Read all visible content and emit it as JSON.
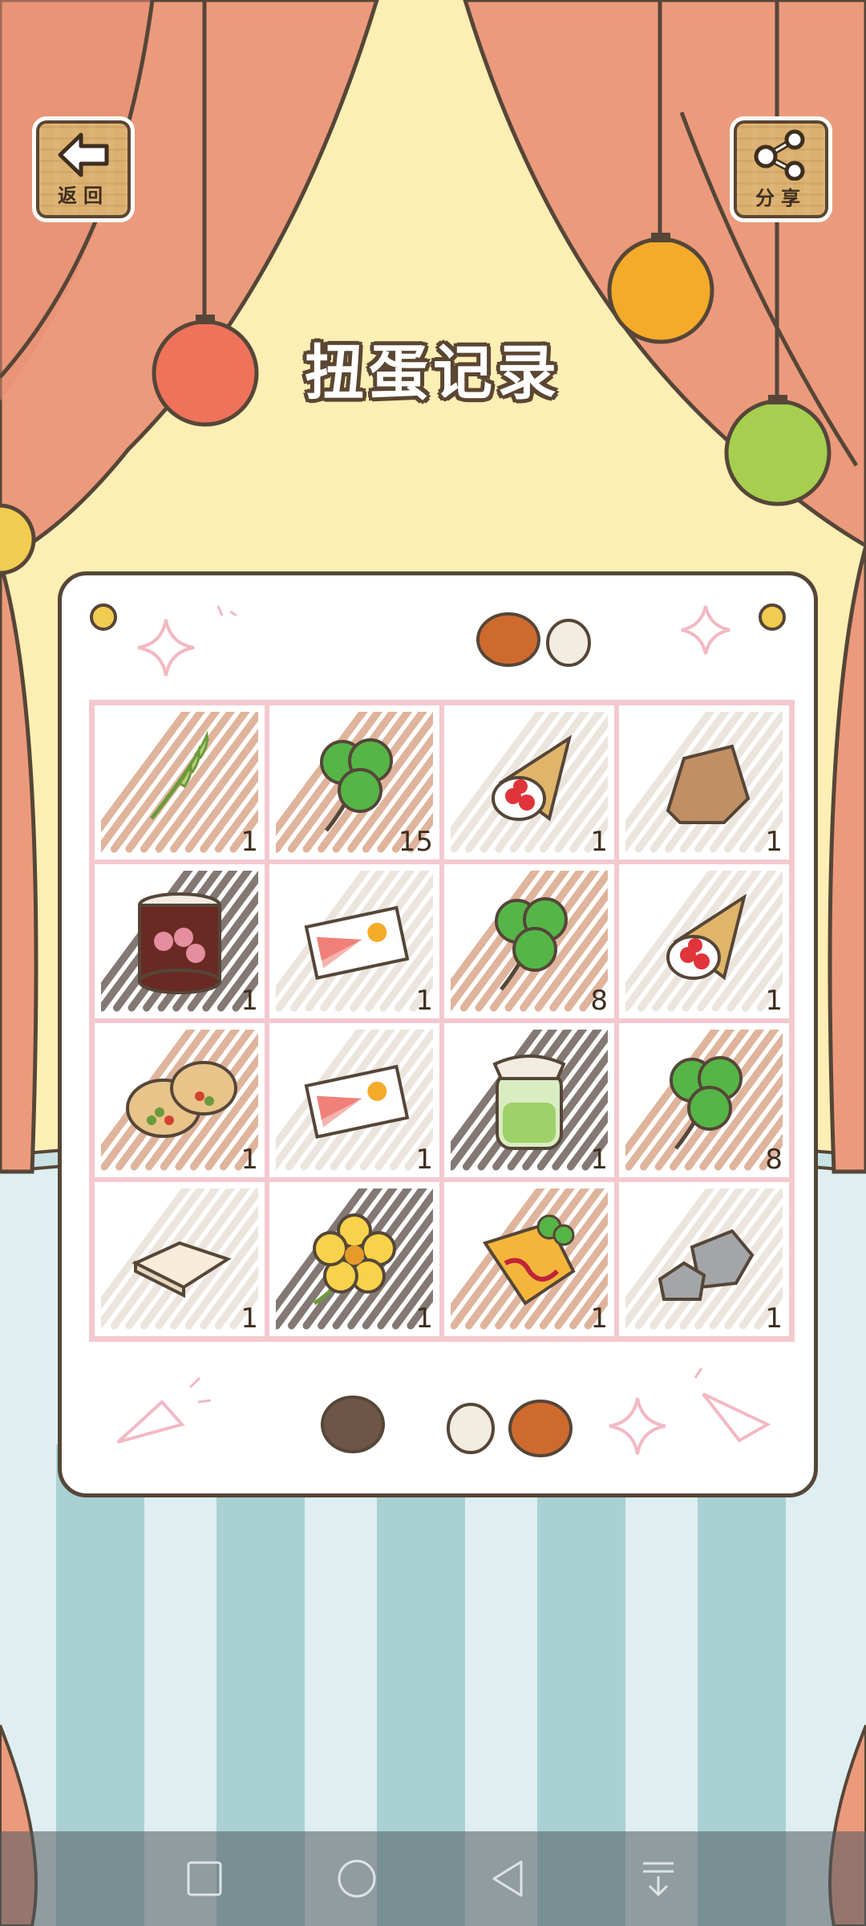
{
  "title": "扭蛋记录",
  "back_button": {
    "label": "返回",
    "icon": "arrow-left-icon"
  },
  "share_button": {
    "label": "分享",
    "icon": "share-icon"
  },
  "colors": {
    "curtain": "#ec9a7c",
    "wall": "#fdeeb4",
    "card_border": "#554638",
    "grid_line": "#f3c9cf"
  },
  "items": [
    {
      "name": "grass-stalk",
      "count": "1",
      "bg": "#d59b7c"
    },
    {
      "name": "clover",
      "count": "15",
      "bg": "#d59b7c"
    },
    {
      "name": "strawberry-crepe",
      "count": "1",
      "bg": "#e5ddd4"
    },
    {
      "name": "rock",
      "count": "1",
      "bg": "#e5ddd4"
    },
    {
      "name": "red-bean-can",
      "count": "1",
      "bg": "#5a4b45"
    },
    {
      "name": "amulet-ticket",
      "count": "1",
      "bg": "#e5ddd4"
    },
    {
      "name": "clover",
      "count": "8",
      "bg": "#d59b7c"
    },
    {
      "name": "strawberry-crepe",
      "count": "1",
      "bg": "#e5ddd4"
    },
    {
      "name": "bean-buns",
      "count": "1",
      "bg": "#d59b7c"
    },
    {
      "name": "amulet-ticket",
      "count": "1",
      "bg": "#e5ddd4"
    },
    {
      "name": "green-jam-jar",
      "count": "1",
      "bg": "#5a4b45"
    },
    {
      "name": "clover",
      "count": "8",
      "bg": "#d59b7c"
    },
    {
      "name": "tofu-sheet",
      "count": "1",
      "bg": "#e5ddd4"
    },
    {
      "name": "yellow-flower",
      "count": "1",
      "bg": "#5a4b45"
    },
    {
      "name": "omelette-wrap",
      "count": "1",
      "bg": "#d59b7c"
    },
    {
      "name": "grey-stones",
      "count": "1",
      "bg": "#e5ddd4"
    }
  ],
  "nav": [
    "recent-apps-icon",
    "home-icon",
    "back-icon",
    "notification-pull-icon"
  ]
}
